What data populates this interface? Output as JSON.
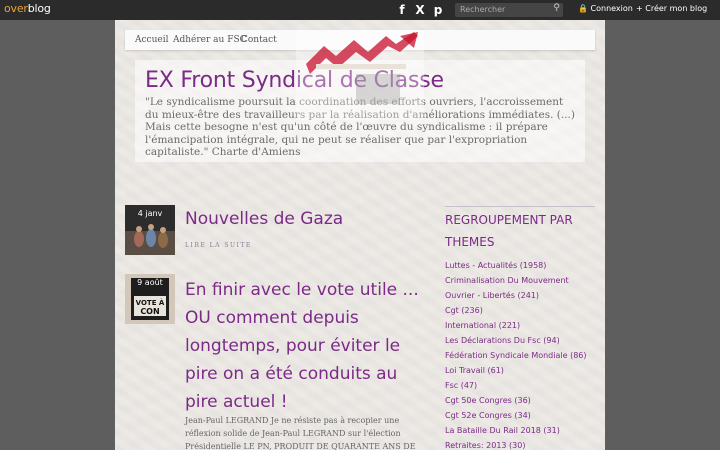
{
  "topbar": {
    "logo_over": "over",
    "logo_blog": "blog",
    "social": [
      "f",
      "X",
      "p"
    ],
    "search_placeholder": "Rechercher",
    "connexion": "Connexion",
    "creer": "Créer mon blog"
  },
  "nav": {
    "items": [
      "Accueil",
      "Adhérer au FSC",
      "Contact"
    ]
  },
  "header": {
    "title": "EX Front Syndical de Classe",
    "description": "\"Le syndicalisme poursuit la coordination des efforts ouvriers, l'accroissement du mieux-être des travailleurs par la réalisation d'améliorations immédiates. (...) Mais cette besogne n'est qu'un côté de l'œuvre du syndicalisme : il prépare l'émancipation intégrale, qui ne peut se réaliser que par l'expropriation capitaliste.\" Charte d'Amiens"
  },
  "articles": [
    {
      "date": "4 janv",
      "title": "Nouvelles de Gaza",
      "readmore": "LIRE LA SUITE"
    },
    {
      "date": "9 août",
      "title": "En finir avec le vote utile ... OU comment depuis longtemps, pour éviter le pire on a été conduits au pire actuel !",
      "excerpt": "Jean-Paul LEGRAND Je ne résiste pas à recopier une réflexion solide de Jean-Paul LEGRAND sur l'élection Présidentielle LE PN, PRODUIT DE QUARANTE ANS DE POLITIQUES LIBÉRALES À",
      "thumb_text": "VOTE À CON"
    }
  ],
  "sidebar": {
    "title": "REGROUPEMENT PAR THEMES",
    "items": [
      "Luttes - Actualités (1958)",
      "Criminalisation Du Mouvement Ouvrier - Libertés (241)",
      "Cgt (236)",
      "International (221)",
      "Les Déclarations Du Fsc (94)",
      "Fédération Syndicale Mondiale (86)",
      "Loi Travail (61)",
      "Fsc (47)",
      "Cgt 50e Congres (36)",
      "Cgt 52e Congres (34)",
      "La Bataille Du Rail 2018 (31)",
      "Retraites: 2013 (30)"
    ]
  },
  "colors": {
    "accent": "#7b2a86",
    "topbar": "#2b2b2b",
    "page": "#edeae6"
  }
}
